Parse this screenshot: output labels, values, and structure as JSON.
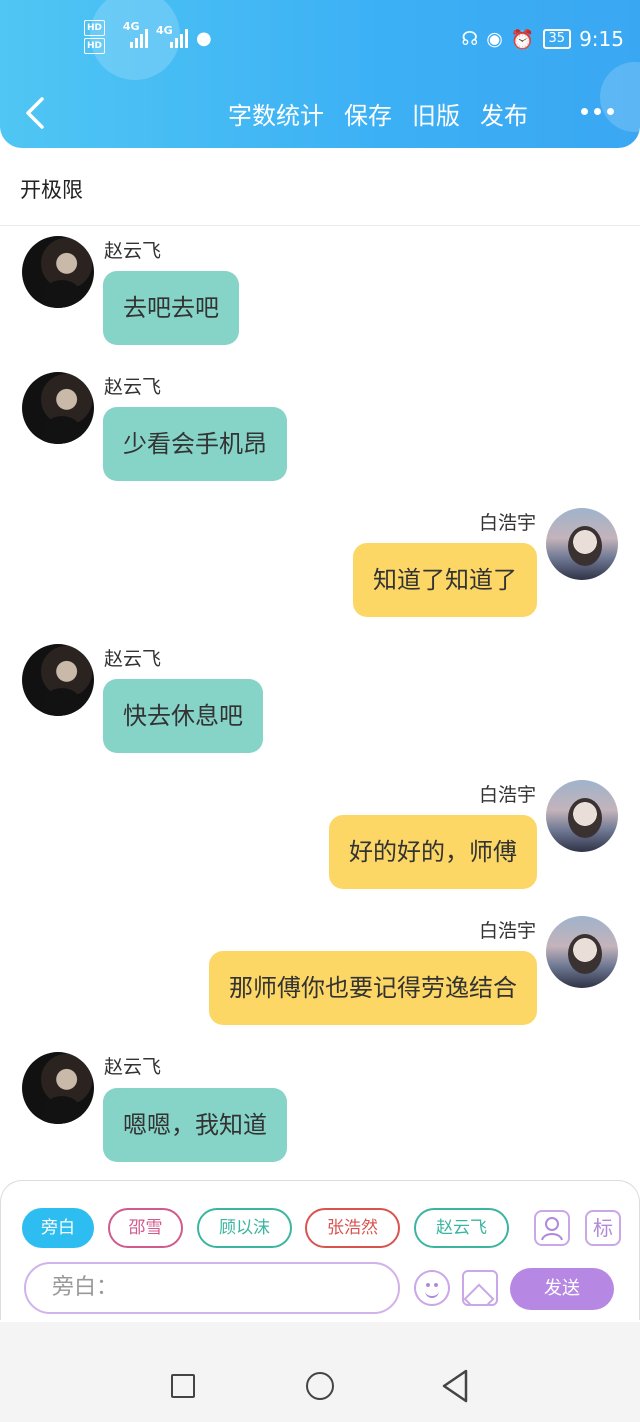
{
  "status_bar": {
    "hd1": "HD",
    "hd2": "HD",
    "net1": "4G",
    "net2": "4G",
    "battery": "35",
    "time": "9:15"
  },
  "header": {
    "actions": [
      "字数统计",
      "保存",
      "旧版",
      "发布"
    ]
  },
  "title": "开极限",
  "messages": [
    {
      "side": "left",
      "name": "赵云飞",
      "text": "去吧去吧"
    },
    {
      "side": "left",
      "name": "赵云飞",
      "text": "少看会手机昂"
    },
    {
      "side": "right",
      "name": "白浩宇",
      "text": "知道了知道了"
    },
    {
      "side": "left",
      "name": "赵云飞",
      "text": "快去休息吧"
    },
    {
      "side": "right",
      "name": "白浩宇",
      "text": "好的好的，师傅"
    },
    {
      "side": "right",
      "name": "白浩宇",
      "text": "那师傅你也要记得劳逸结合"
    },
    {
      "side": "left",
      "name": "赵云飞",
      "text": "嗯嗯，我知道"
    }
  ],
  "characters": [
    {
      "label": "旁白",
      "active": true,
      "color": "#2ebdf0"
    },
    {
      "label": "邵雪",
      "active": false,
      "color": "#d05a8c"
    },
    {
      "label": "顾以沫",
      "active": false,
      "color": "#3bb5a0"
    },
    {
      "label": "张浩然",
      "active": false,
      "color": "#d9534f"
    },
    {
      "label": "赵云飞",
      "active": false,
      "color": "#3bb5a0"
    }
  ],
  "tools": {
    "mark_label": "标"
  },
  "input": {
    "placeholder": "旁白："
  },
  "send_label": "发送"
}
